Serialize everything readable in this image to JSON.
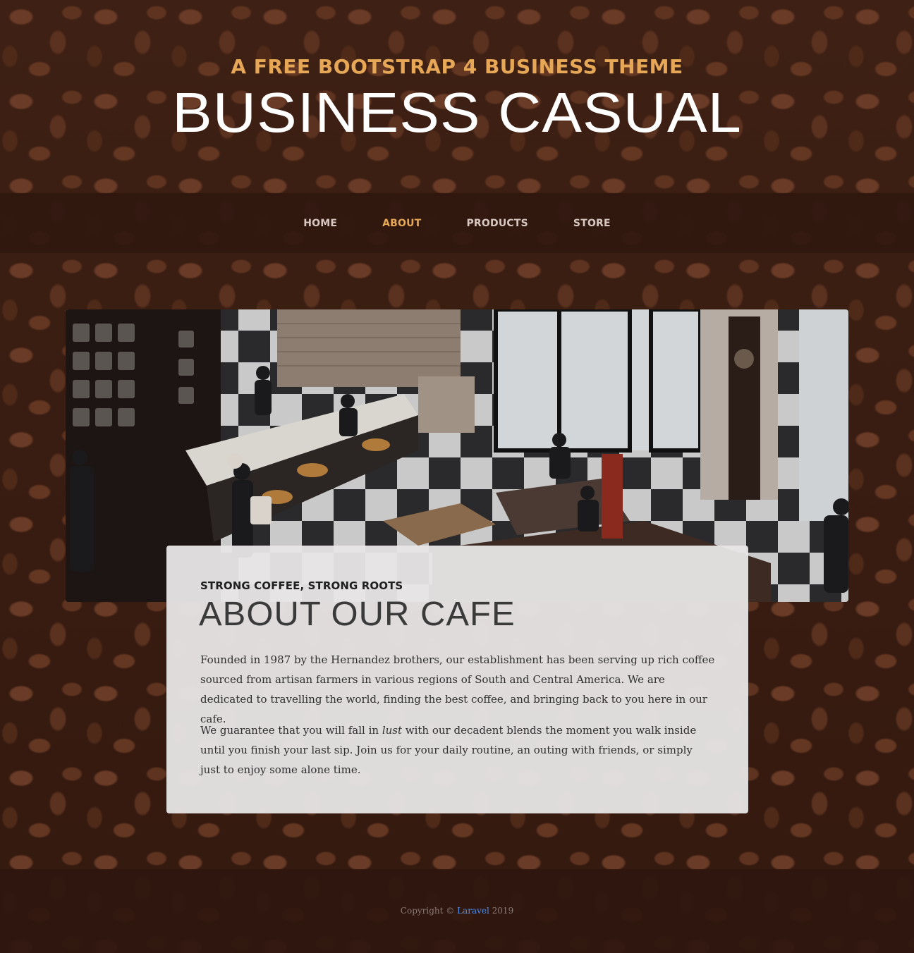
{
  "header": {
    "upper": "A FREE BOOTSTRAP 4 BUSINESS THEME",
    "lower": "BUSINESS CASUAL"
  },
  "nav": {
    "items": [
      {
        "label": "HOME",
        "active": false
      },
      {
        "label": "ABOUT",
        "active": true
      },
      {
        "label": "PRODUCTS",
        "active": false
      },
      {
        "label": "STORE",
        "active": false
      }
    ]
  },
  "about": {
    "image_alt": "cafe interior photo",
    "heading_upper": "STRONG COFFEE, STRONG ROOTS",
    "heading_lower": "ABOUT OUR CAFE",
    "p1": "Founded in 1987 by the Hernandez brothers, our establishment has been serving up rich coffee sourced from artisan farmers in various regions of South and Central America. We are dedicated to travelling the world, finding the best coffee, and bringing back to you here in our cafe.",
    "p2_before": "We guarantee that you will fall in ",
    "p2_em": "lust",
    "p2_after": " with our decadent blends the moment you walk inside until you finish your last sip. Join us for your daily routine, an outing with friends, or simply just to enjoy some alone time."
  },
  "footer": {
    "prefix": "Copyright © ",
    "link": "Laravel",
    "suffix": " 2019"
  },
  "colors": {
    "accent": "#e6a756",
    "nav_bg": "#2f170f",
    "link": "#4d8ee8"
  }
}
